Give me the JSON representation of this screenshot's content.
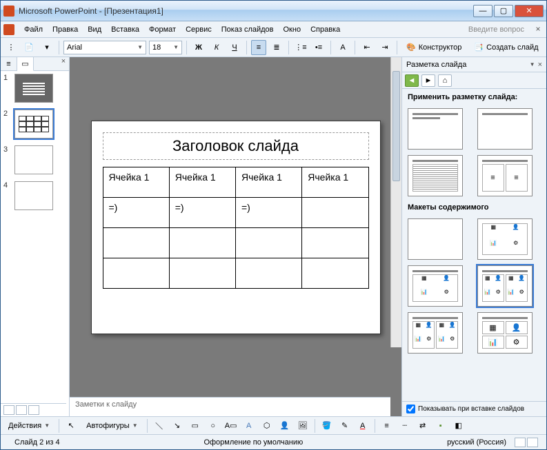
{
  "window": {
    "title": "Microsoft PowerPoint - [Презентация1]"
  },
  "menu": {
    "items": [
      "Файл",
      "Правка",
      "Вид",
      "Вставка",
      "Формат",
      "Сервис",
      "Показ слайдов",
      "Окно",
      "Справка"
    ],
    "help_placeholder": "Введите вопрос"
  },
  "toolbar": {
    "font": "Arial",
    "size": "18",
    "designer": "Конструктор",
    "new_slide": "Создать слайд"
  },
  "thumbs": {
    "count": 4,
    "selected": 2
  },
  "slide": {
    "title": "Заголовок слайда",
    "rows": [
      [
        "Ячейка 1",
        "Ячейка 1",
        "Ячейка 1",
        "Ячейка 1"
      ],
      [
        "=)",
        "=)",
        "=)",
        ""
      ],
      [
        "",
        "",
        "",
        ""
      ],
      [
        "",
        "",
        "",
        ""
      ]
    ]
  },
  "notes": {
    "placeholder": "Заметки к слайду"
  },
  "task": {
    "title": "Разметка слайда",
    "apply_label": "Применить разметку слайда:",
    "content_label": "Макеты содержимого",
    "show_insert": "Показывать при вставке слайдов"
  },
  "bottom": {
    "actions": "Действия",
    "autoshapes": "Автофигуры"
  },
  "status": {
    "slide_pos": "Слайд 2 из 4",
    "design": "Оформление по умолчанию",
    "lang": "русский (Россия)"
  }
}
